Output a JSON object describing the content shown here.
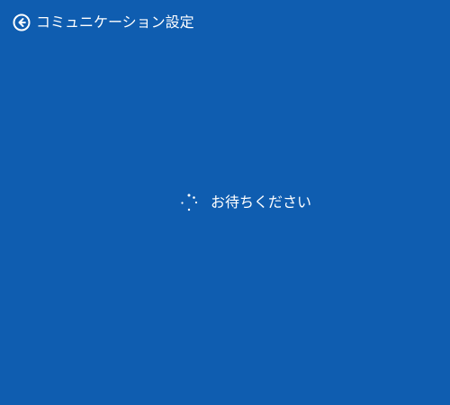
{
  "header": {
    "title": "コミュニケーション設定",
    "back_icon": "back-arrow-icon"
  },
  "loading": {
    "text": "お待ちください",
    "spinner_icon": "loading-spinner-icon"
  },
  "colors": {
    "background": "#0f5db0",
    "foreground": "#ffffff"
  }
}
